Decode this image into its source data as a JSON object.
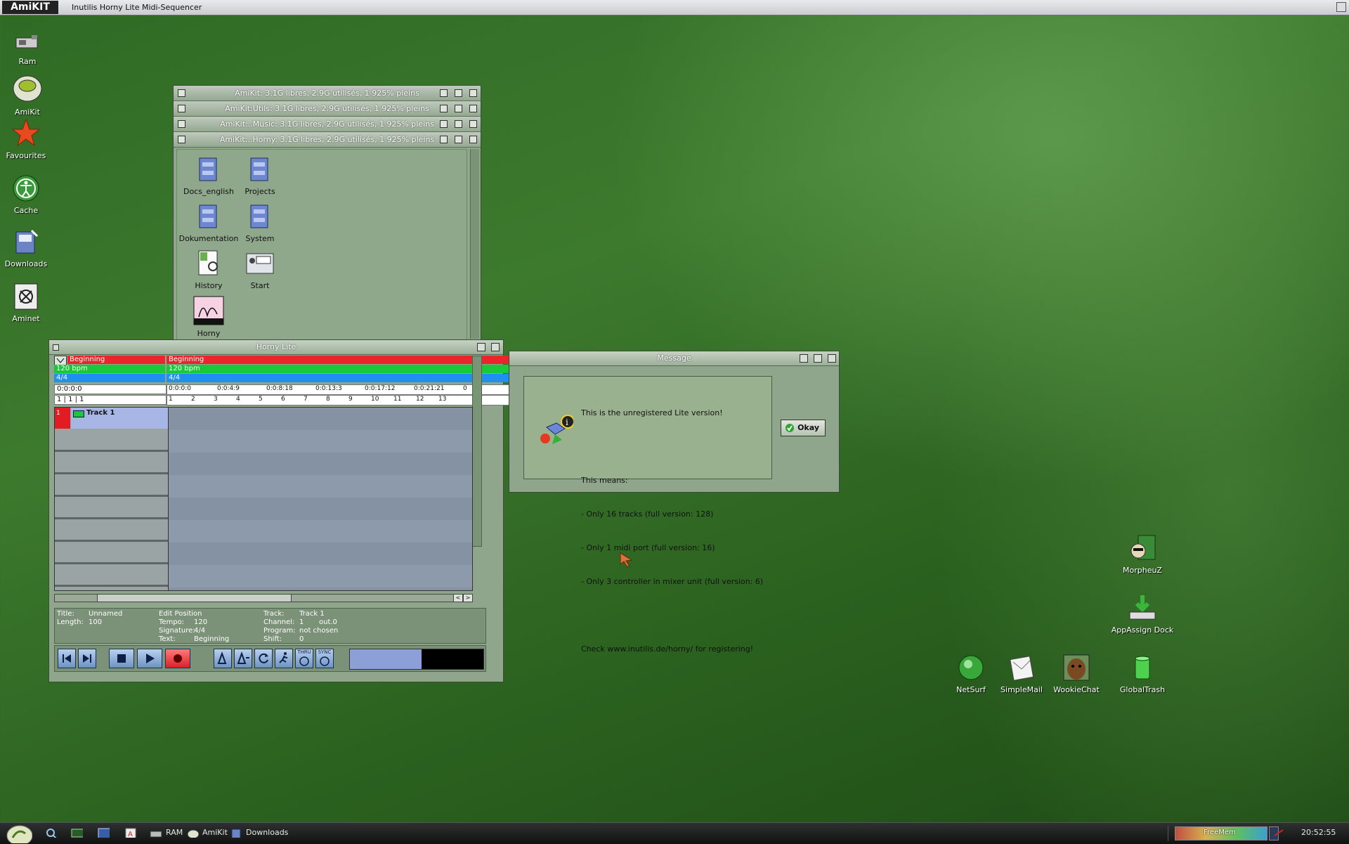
{
  "menubar": {
    "logo": "AmiKIT",
    "title": "Inutilis Horny Lite Midi-Sequencer"
  },
  "desktop_icons_left": [
    {
      "label": "Ram"
    },
    {
      "label": "AmiKit"
    },
    {
      "label": "Favourites"
    },
    {
      "label": "Cache"
    },
    {
      "label": "Downloads"
    },
    {
      "label": "Aminet"
    }
  ],
  "desktop_icons_right": {
    "morpheuz": "MorpheuZ",
    "appassign": "AppAssign Dock",
    "netsurf": "NetSurf",
    "simplemail": "SimpleMail",
    "wookiechat": "WookieChat",
    "globaltrash": "GlobalTrash"
  },
  "drawers": [
    "AmiKit:  3.1G libres, 2.9G utilisés, 1 925% pleins",
    "AmiKit:Utils:  3.1G libres, 2.9G utilisés, 1 925% pleins",
    "AmiKit:..Music:  3.1G libres, 2.9G utilisés, 1 925% pleins",
    "AmiKit:..Horny:  3.1G libres, 2.9G utilisés, 1 925% pleins"
  ],
  "drawer_icons": {
    "docs_english": "Docs_english",
    "projects": "Projects",
    "dokumentation": "Dokumentation",
    "system": "System",
    "history": "History",
    "start": "Start",
    "horny": "Horny"
  },
  "horny": {
    "title": "Horny Lite",
    "marker": "Beginning",
    "tempo": "120 bpm",
    "signature": "4/4",
    "time_pos": "0:0:0:0",
    "bar_pos": "1 | 1 | 1",
    "time_ruler": [
      "0:0:0:0",
      "0:0:4:9",
      "0:0:8:18",
      "0:0:13:3",
      "0:0:17:12",
      "0:0:21:21",
      "0"
    ],
    "bar_ruler": [
      "1",
      "2",
      "3",
      "4",
      "5",
      "6",
      "7",
      "8",
      "9",
      "10",
      "11",
      "12",
      "13"
    ],
    "track_num": "1",
    "track_name": "Track 1",
    "info": {
      "title_label": "Title:",
      "title_value": "Unnamed",
      "length_label": "Length:",
      "length_value": "100",
      "edit_heading": "Edit Position",
      "tempo_label": "Tempo:",
      "tempo_value": "120",
      "sig_label": "Signature:",
      "sig_value": "4/4",
      "text_label": "Text:",
      "text_value": "Beginning",
      "track_label": "Track:",
      "track_value": "Track 1",
      "channel_label": "Channel:",
      "channel_value": "1",
      "out_value": "out.0",
      "program_label": "Program:",
      "program_value": "not chosen",
      "shift_label": "Shift:",
      "shift_value": "0"
    },
    "transport_small": {
      "thru": "THRU",
      "sync": "SYNC"
    }
  },
  "message": {
    "title": "Message",
    "line1": "This is the unregistered Lite version!",
    "line2": "This means:",
    "line3": "- Only 16 tracks (full version: 128)",
    "line4": "- Only 1 midi port (full version: 16)",
    "line5": "- Only 3 controller in mixer unit (full version: 6)",
    "line6": "Check www.inutilis.de/horny/ for registering!",
    "okay": "Okay"
  },
  "taskbar": {
    "items": [
      "RAM",
      "AmiKit",
      "Downloads"
    ],
    "meter_label": "FreeMem",
    "clock": "20:52:55"
  },
  "colors": {
    "marker_red": "#e8262b",
    "tempo_green": "#19c93a",
    "sig_blue": "#1f8ff0",
    "track_red": "#e31b22"
  }
}
